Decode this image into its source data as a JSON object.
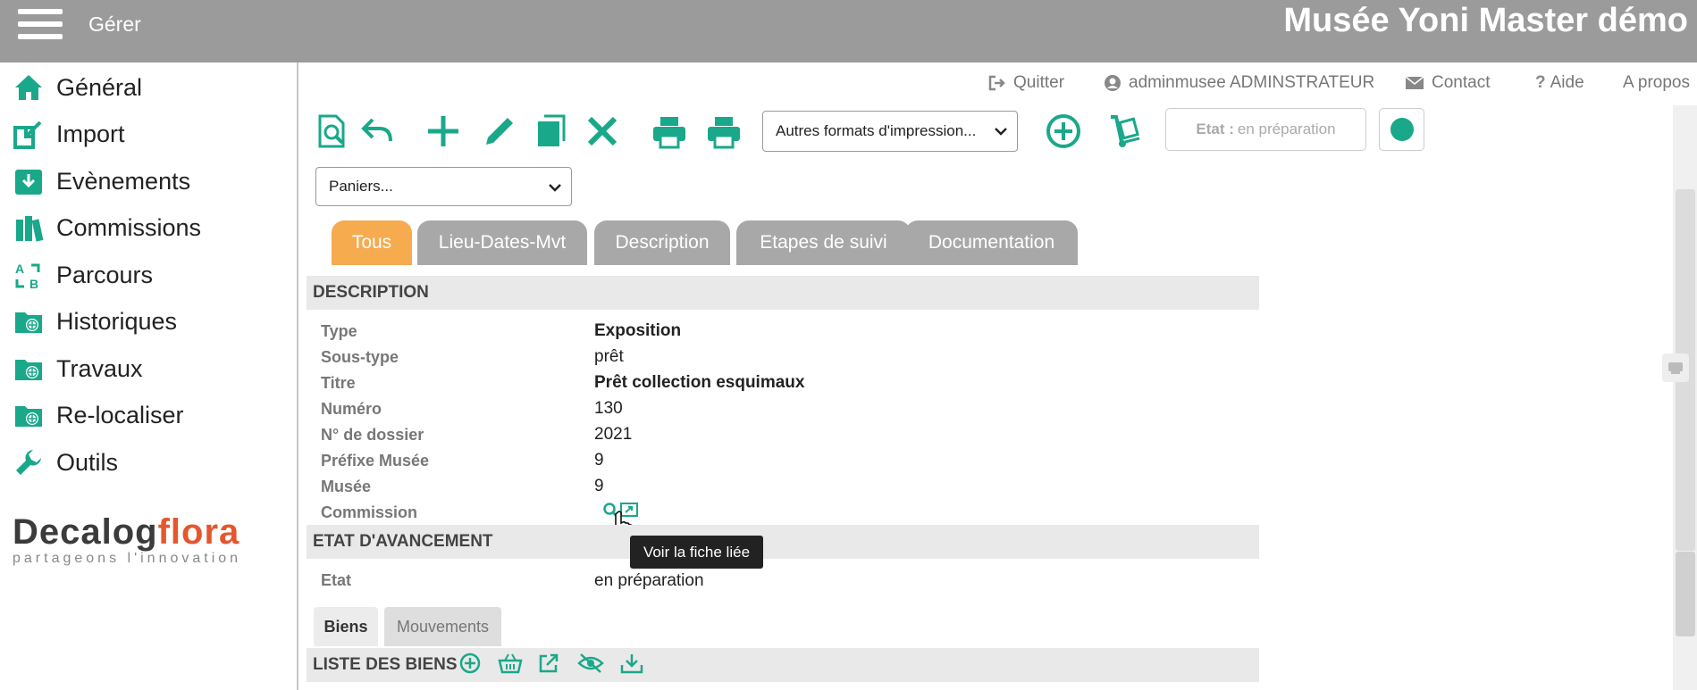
{
  "header": {
    "menu_label": "Gérer",
    "title": "Musée Yoni Master démo"
  },
  "sidebar": {
    "items": [
      {
        "label": "Général",
        "icon": "home-icon"
      },
      {
        "label": "Import",
        "icon": "import-icon"
      },
      {
        "label": "Evènements",
        "icon": "download-box-icon"
      },
      {
        "label": "Commissions",
        "icon": "books-icon"
      },
      {
        "label": "Parcours",
        "icon": "route-icon"
      },
      {
        "label": "Historiques",
        "icon": "folder-globe-icon"
      },
      {
        "label": "Travaux",
        "icon": "folder-globe-icon"
      },
      {
        "label": "Re-localiser",
        "icon": "folder-globe-icon"
      },
      {
        "label": "Outils",
        "icon": "wrench-icon"
      }
    ],
    "logo": {
      "part1": "Decalog",
      "part2": "flora",
      "tagline": "partageons l'innovation"
    }
  },
  "toplinks": {
    "quit": "Quitter",
    "user": "adminmusee ADMINSTRATEUR",
    "contact": "Contact",
    "help": "Aide",
    "about": "A propos"
  },
  "toolbar": {
    "print_formats": "Autres formats d'impression...",
    "etat_label": "Etat :",
    "etat_value": "en préparation",
    "baskets": "Paniers..."
  },
  "tabs": [
    "Tous",
    "Lieu-Dates-Mvt",
    "Description",
    "Etapes de suivi",
    "Documentation"
  ],
  "description": {
    "section_title": "DESCRIPTION",
    "fields": [
      {
        "label": "Type",
        "value": "Exposition"
      },
      {
        "label": "Sous-type",
        "value": "prêt"
      },
      {
        "label": "Titre",
        "value": "Prêt collection esquimaux"
      },
      {
        "label": "Numéro",
        "value": "130"
      },
      {
        "label": "N° de dossier",
        "value": "2021"
      },
      {
        "label": "Préfixe Musée",
        "value": "9"
      },
      {
        "label": "Musée",
        "value": "9"
      },
      {
        "label": "Commission",
        "value": ""
      }
    ]
  },
  "tooltip": "Voir la fiche liée",
  "avancement": {
    "section_title": "ETAT D'AVANCEMENT",
    "label": "Etat",
    "value": "en préparation"
  },
  "subtabs": [
    "Biens",
    "Mouvements"
  ],
  "list": {
    "title": "LISTE DES BIENS"
  },
  "colors": {
    "accent": "#1aa88a",
    "active_tab": "#f6ab4f",
    "inactive_tab": "#a8a8a8",
    "header": "#9b9b9b"
  }
}
